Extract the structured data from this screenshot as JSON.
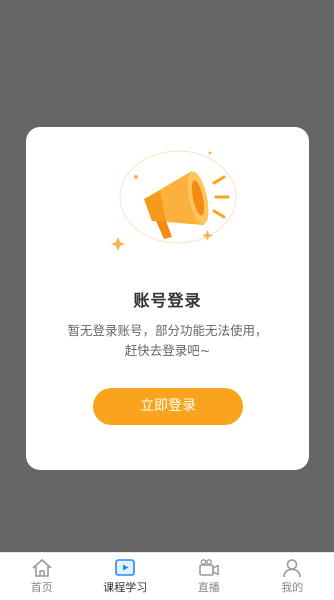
{
  "modal": {
    "title": "账号登录",
    "message_line1": "暂无登录账号，部分功能无法使用，",
    "message_line2": "赶快去登录吧~",
    "login_button": "立即登录"
  },
  "tabbar": {
    "active_index": 1,
    "items": [
      {
        "label": "首页",
        "icon": "home-icon"
      },
      {
        "label": "课程学习",
        "icon": "video-play-icon"
      },
      {
        "label": "直播",
        "icon": "camera-icon"
      },
      {
        "label": "我的",
        "icon": "user-icon"
      }
    ]
  },
  "colors": {
    "overlay": "#666666",
    "accent": "#f9a41c",
    "active_tab": "#1a8cff",
    "tab_icon": "#999999"
  }
}
